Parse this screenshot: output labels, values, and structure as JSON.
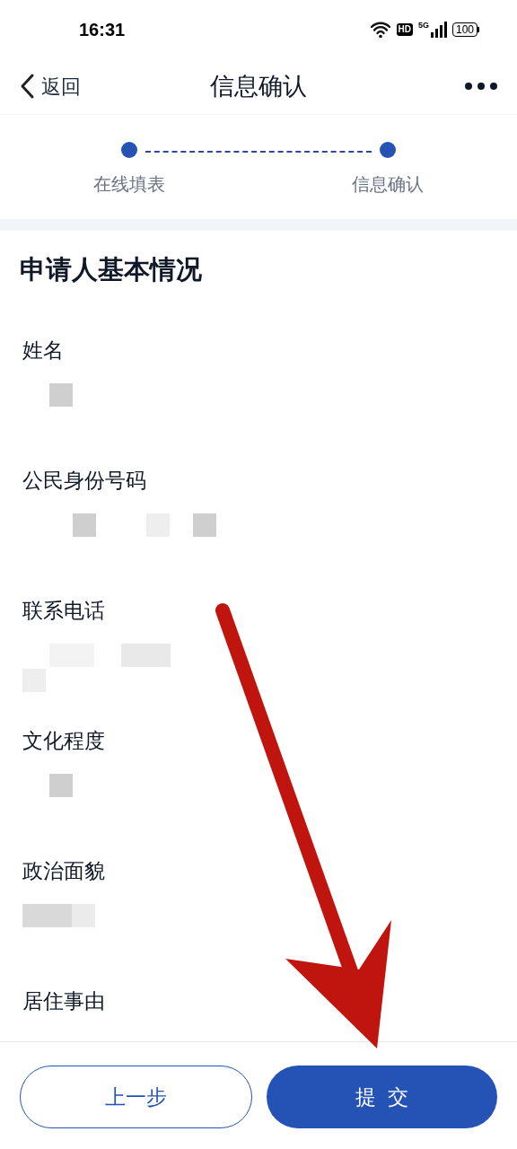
{
  "status_bar": {
    "time": "16:31",
    "hd": "HD",
    "network": "5G",
    "battery": "100"
  },
  "header": {
    "back": "返回",
    "title": "信息确认"
  },
  "steps": [
    {
      "label": "在线填表"
    },
    {
      "label": "信息确认"
    }
  ],
  "section_title": "申请人基本情况",
  "fields": [
    {
      "label": "姓名",
      "redacted": true
    },
    {
      "label": "公民身份号码",
      "redacted": true
    },
    {
      "label": "联系电话",
      "redacted": true
    },
    {
      "label": "文化程度",
      "redacted": true
    },
    {
      "label": "政治面貌",
      "redacted": true
    },
    {
      "label": "居住事由"
    }
  ],
  "buttons": [
    {
      "label": "上一步",
      "kind": "secondary"
    },
    {
      "label": "提  交",
      "kind": "primary"
    }
  ]
}
